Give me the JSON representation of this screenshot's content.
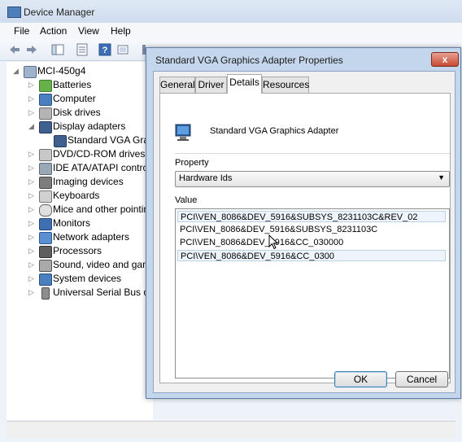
{
  "device_manager": {
    "title": "Device Manager",
    "menu": [
      "File",
      "Action",
      "View",
      "Help"
    ],
    "tree": {
      "root": "MCI-450g4",
      "items": [
        {
          "label": "Batteries",
          "icon": "battery-icon",
          "expanded": false
        },
        {
          "label": "Computer",
          "icon": "computer-icon",
          "expanded": false
        },
        {
          "label": "Disk drives",
          "icon": "disk-drive-icon",
          "expanded": false
        },
        {
          "label": "Display adapters",
          "icon": "display-adapter-icon",
          "expanded": true
        },
        {
          "label": "Standard VGA Grap",
          "icon": "display-adapter-icon",
          "child": true
        },
        {
          "label": "DVD/CD-ROM drives",
          "icon": "dvd-drive-icon",
          "expanded": false
        },
        {
          "label": "IDE ATA/ATAPI contro",
          "icon": "ide-controller-icon",
          "expanded": false
        },
        {
          "label": "Imaging devices",
          "icon": "camera-icon",
          "expanded": false
        },
        {
          "label": "Keyboards",
          "icon": "keyboard-icon",
          "expanded": false
        },
        {
          "label": "Mice and other pointin",
          "icon": "mouse-icon",
          "expanded": false
        },
        {
          "label": "Monitors",
          "icon": "monitor-icon",
          "expanded": false
        },
        {
          "label": "Network adapters",
          "icon": "network-icon",
          "expanded": false
        },
        {
          "label": "Processors",
          "icon": "processor-icon",
          "expanded": false
        },
        {
          "label": "Sound, video and gam",
          "icon": "speaker-icon",
          "expanded": false
        },
        {
          "label": "System devices",
          "icon": "system-device-icon",
          "expanded": false
        },
        {
          "label": "Universal Serial Bus co",
          "icon": "usb-icon",
          "expanded": false
        }
      ]
    }
  },
  "dialog": {
    "title": "Standard VGA Graphics Adapter Properties",
    "close_label": "x",
    "tabs": [
      "General",
      "Driver",
      "Details",
      "Resources"
    ],
    "active_tab": "Details",
    "device_name": "Standard VGA Graphics Adapter",
    "property_label": "Property",
    "property_value": "Hardware Ids",
    "value_label": "Value",
    "values": [
      "PCI\\VEN_8086&DEV_5916&SUBSYS_8231103C&REV_02",
      "PCI\\VEN_8086&DEV_5916&SUBSYS_8231103C",
      "PCI\\VEN_8086&DEV_5916&CC_030000",
      "PCI\\VEN_8086&DEV_5916&CC_0300"
    ],
    "ok_label": "OK",
    "cancel_label": "Cancel"
  }
}
